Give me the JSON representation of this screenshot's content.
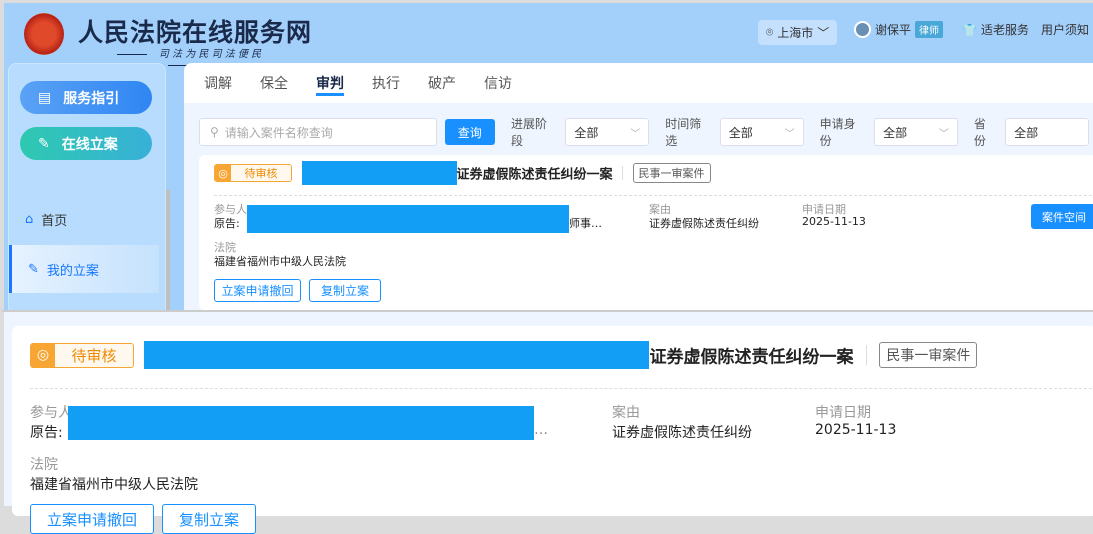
{
  "header": {
    "title": "人民法院在线服务网",
    "slogan": "司 法 为 民   司 法 便 民",
    "city": "上海市",
    "user": "谢保平",
    "user_role": "律师",
    "elderly": "适老服务",
    "notice": "用户须知"
  },
  "sidebar": {
    "guide": "服务指引",
    "file_case": "在线立案",
    "items": [
      {
        "label": "首页"
      },
      {
        "label": "我的立案"
      }
    ]
  },
  "tabs": [
    "调解",
    "保全",
    "审判",
    "执行",
    "破产",
    "信访"
  ],
  "filters": {
    "search_placeholder": "请输入案件名称查询",
    "query": "查询",
    "stage_label": "进展阶段",
    "stage": "全部",
    "time_label": "时间筛选",
    "time": "全部",
    "identity_label": "申请身份",
    "identity": "全部",
    "province_label": "省份",
    "province": "全部"
  },
  "case": {
    "status": "待审核",
    "title": "证券虚假陈述责任纠纷一案",
    "type": "民事一审案件",
    "participants_label": "参与人",
    "participants_prefix": "原告:",
    "participants_suffix": "师事…",
    "participants_suffix_zoom": "…",
    "cause_label": "案由",
    "cause": "证券虚假陈述责任纠纷",
    "date_label": "申请日期",
    "date": "2025-11-13",
    "court_label": "法院",
    "court": "福建省福州市中级人民法院",
    "withdraw": "立案申请撤回",
    "copy": "复制立案",
    "space": "案件空间"
  }
}
